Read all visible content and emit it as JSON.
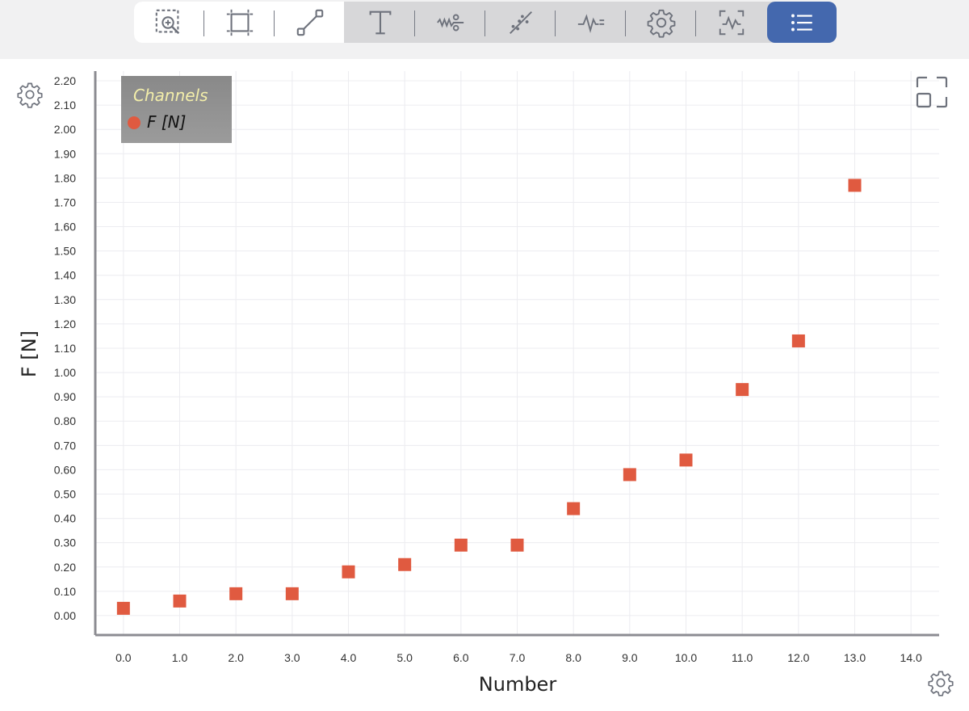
{
  "toolbar": {
    "tools": [
      {
        "name": "zoom-region-tool",
        "icon": "zoom-region-icon"
      },
      {
        "name": "selection-box-tool",
        "icon": "selection-box-icon"
      },
      {
        "name": "line-tool",
        "icon": "line-segment-icon"
      },
      {
        "name": "text-tool",
        "icon": "text-icon"
      },
      {
        "name": "smoothing-tool",
        "icon": "smoothing-icon"
      },
      {
        "name": "fit-tool",
        "icon": "fit-line-icon"
      },
      {
        "name": "signal-tool",
        "icon": "signal-icon"
      },
      {
        "name": "settings-tool",
        "icon": "gear-icon"
      },
      {
        "name": "analysis-tool",
        "icon": "waveform-box-icon"
      },
      {
        "name": "list-tool",
        "icon": "list-icon"
      }
    ],
    "active_color": "#4468ae"
  },
  "legend": {
    "title": "Channels",
    "items": [
      {
        "label": "F [N]",
        "color": "#e05a40"
      }
    ]
  },
  "chart_data": {
    "type": "scatter",
    "xlabel": "Number",
    "ylabel": "F [N]",
    "xlim": [
      -0.5,
      14.5
    ],
    "ylim": [
      -0.08,
      2.24
    ],
    "x_ticks": [
      "0.0",
      "1.0",
      "2.0",
      "3.0",
      "4.0",
      "5.0",
      "6.0",
      "7.0",
      "8.0",
      "9.0",
      "10.0",
      "11.0",
      "12.0",
      "13.0",
      "14.0"
    ],
    "y_ticks": [
      "0.00",
      "0.10",
      "0.20",
      "0.30",
      "0.40",
      "0.50",
      "0.60",
      "0.70",
      "0.80",
      "0.90",
      "1.00",
      "1.10",
      "1.20",
      "1.30",
      "1.40",
      "1.50",
      "1.60",
      "1.70",
      "1.80",
      "1.90",
      "2.00",
      "2.10",
      "2.20"
    ],
    "grid": true,
    "legend_position": "top-left",
    "series": [
      {
        "name": "F [N]",
        "color": "#e05a40",
        "marker": "square",
        "x": [
          0,
          1,
          2,
          3,
          4,
          5,
          6,
          7,
          8,
          9,
          10,
          11,
          12,
          13
        ],
        "y": [
          0.03,
          0.06,
          0.09,
          0.09,
          0.18,
          0.21,
          0.29,
          0.29,
          0.44,
          0.58,
          0.64,
          0.93,
          1.13,
          1.77
        ]
      }
    ]
  }
}
